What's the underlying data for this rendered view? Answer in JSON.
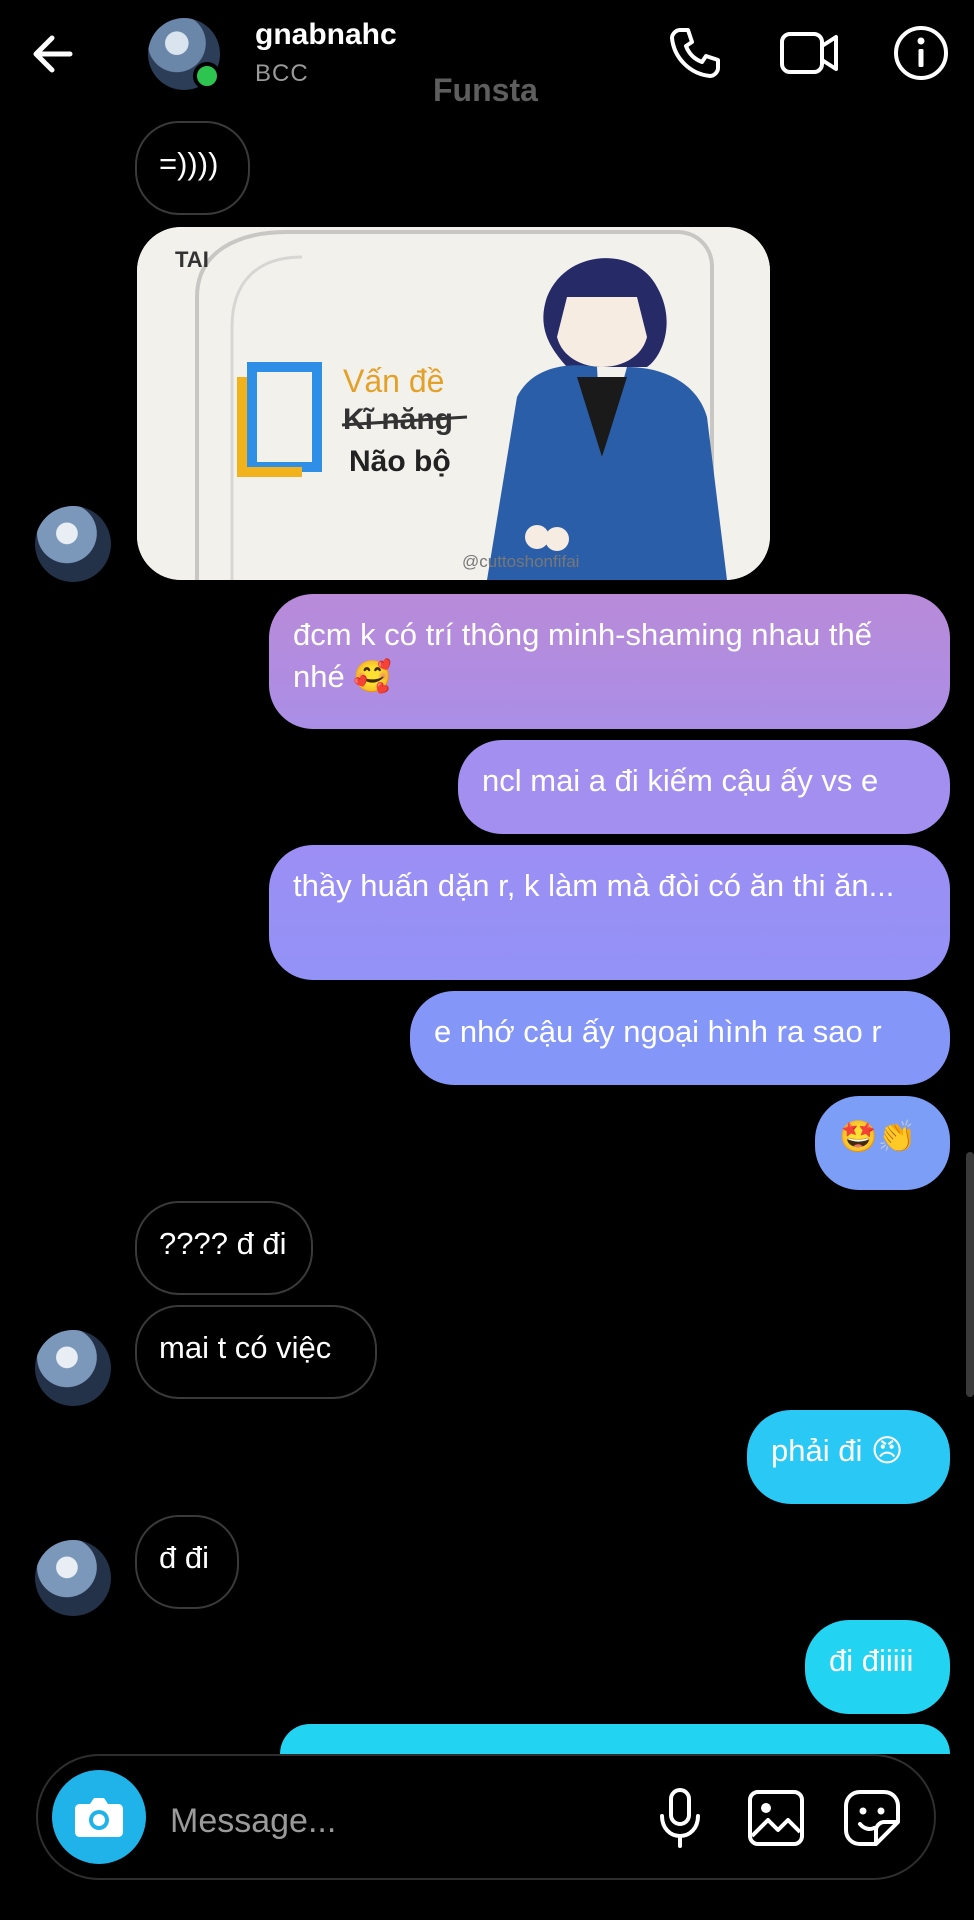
{
  "header": {
    "contact_name": "gnabnahc",
    "contact_subtitle": "BCC",
    "watermark": "Funsta",
    "icons": [
      "back-arrow-icon",
      "phone-icon",
      "video-call-icon",
      "info-icon"
    ]
  },
  "messages": [
    {
      "side": "in",
      "text": "=))))"
    },
    {
      "side": "in",
      "type": "image",
      "image_text": {
        "logo": "TAI",
        "line1": "Vấn đề",
        "line2": "Kĩ năng",
        "line3": "Não bộ",
        "credit": "@cuttoshonfifai"
      }
    },
    {
      "side": "out",
      "text": "đcm k có trí thông minh-shaming nhau thế nhé 🥰"
    },
    {
      "side": "out",
      "text": "ncl mai a đi kiếm cậu ấy vs e"
    },
    {
      "side": "out",
      "text": "thầy huấn dặn r, k làm mà đòi có ăn thi ăn..."
    },
    {
      "side": "out",
      "text": "e nhớ cậu ấy ngoại hình ra sao r"
    },
    {
      "side": "out",
      "text": "🤩👏"
    },
    {
      "side": "in",
      "text": "???? đ đi"
    },
    {
      "side": "in",
      "text": "mai t có việc"
    },
    {
      "side": "out",
      "text": "phải đi 😠"
    },
    {
      "side": "in",
      "text": "đ đi"
    },
    {
      "side": "out",
      "text": "đi điiiii"
    }
  ],
  "composer": {
    "placeholder": "Message...",
    "icons": [
      "camera-icon",
      "microphone-icon",
      "gallery-icon",
      "sticker-icon"
    ]
  },
  "colors": {
    "background": "#000000",
    "incoming_border": "#3a3a3a",
    "online": "#2dc44f",
    "gradient_purple": "#b28be0",
    "gradient_blue": "#7b95f5",
    "gradient_cyan": "#22d3f2"
  }
}
